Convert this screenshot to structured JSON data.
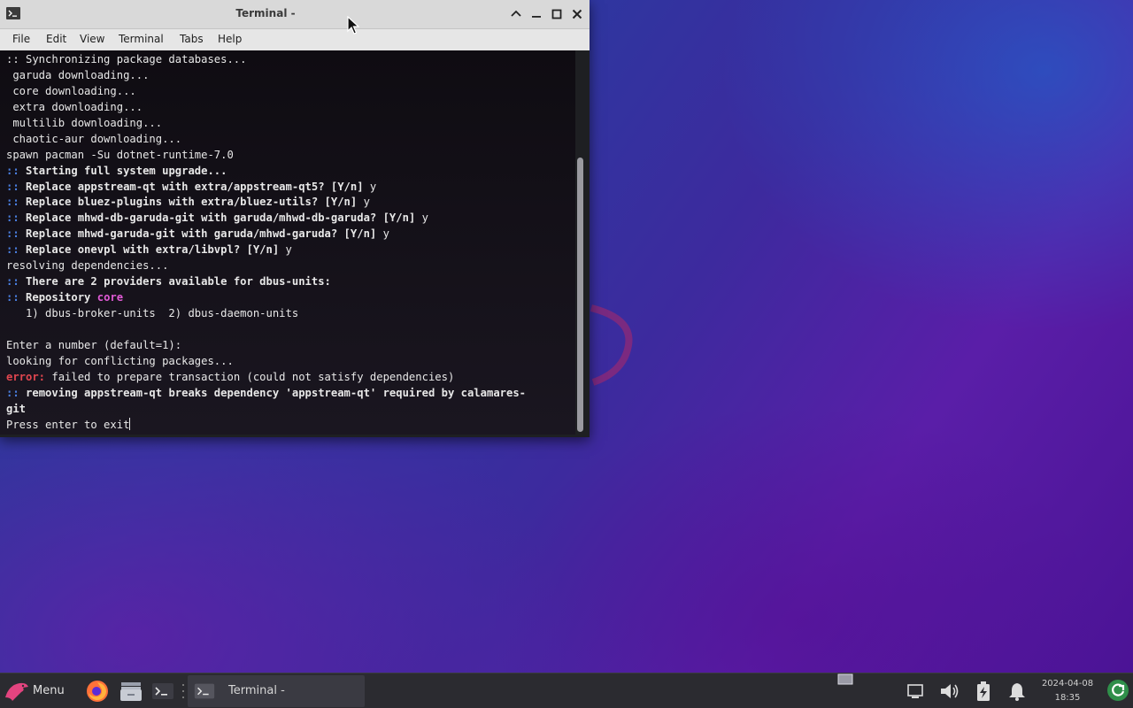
{
  "window": {
    "title": "Terminal -",
    "menu": [
      "File",
      "Edit",
      "View",
      "Terminal",
      "Tabs",
      "Help"
    ]
  },
  "terminal": {
    "lines": [
      [
        {
          "t": ":: Synchronizing package databases...",
          "s": ""
        }
      ],
      [
        {
          "t": " garuda downloading...",
          "s": ""
        }
      ],
      [
        {
          "t": " core downloading...",
          "s": ""
        }
      ],
      [
        {
          "t": " extra downloading...",
          "s": ""
        }
      ],
      [
        {
          "t": " multilib downloading...",
          "s": ""
        }
      ],
      [
        {
          "t": " chaotic-aur downloading...",
          "s": ""
        }
      ],
      [
        {
          "t": "spawn pacman -Su dotnet-runtime-7.0",
          "s": ""
        }
      ],
      [
        {
          "t": "::",
          "s": "blue"
        },
        {
          "t": " Starting full system upgrade...",
          "s": "b"
        }
      ],
      [
        {
          "t": "::",
          "s": "blue"
        },
        {
          "t": " Replace appstream-qt with extra/appstream-qt5? [Y/n]",
          "s": "b"
        },
        {
          "t": " y",
          "s": ""
        }
      ],
      [
        {
          "t": "::",
          "s": "blue"
        },
        {
          "t": " Replace bluez-plugins with extra/bluez-utils? [Y/n]",
          "s": "b"
        },
        {
          "t": " y",
          "s": ""
        }
      ],
      [
        {
          "t": "::",
          "s": "blue"
        },
        {
          "t": " Replace mhwd-db-garuda-git with garuda/mhwd-db-garuda? [Y/n]",
          "s": "b"
        },
        {
          "t": " y",
          "s": ""
        }
      ],
      [
        {
          "t": "::",
          "s": "blue"
        },
        {
          "t": " Replace mhwd-garuda-git with garuda/mhwd-garuda? [Y/n]",
          "s": "b"
        },
        {
          "t": " y",
          "s": ""
        }
      ],
      [
        {
          "t": "::",
          "s": "blue"
        },
        {
          "t": " Replace onevpl with extra/libvpl? [Y/n]",
          "s": "b"
        },
        {
          "t": " y",
          "s": ""
        }
      ],
      [
        {
          "t": "resolving dependencies...",
          "s": ""
        }
      ],
      [
        {
          "t": "::",
          "s": "blue"
        },
        {
          "t": " There are 2 providers available for dbus-units:",
          "s": "b"
        }
      ],
      [
        {
          "t": "::",
          "s": "blue"
        },
        {
          "t": " Repository ",
          "s": "b"
        },
        {
          "t": "core",
          "s": "mag"
        }
      ],
      [
        {
          "t": "   1) dbus-broker-units  2) dbus-daemon-units",
          "s": ""
        }
      ],
      [
        {
          "t": "",
          "s": ""
        }
      ],
      [
        {
          "t": "Enter a number (default=1):",
          "s": ""
        }
      ],
      [
        {
          "t": "looking for conflicting packages...",
          "s": ""
        }
      ],
      [
        {
          "t": "error:",
          "s": "red"
        },
        {
          "t": " failed to prepare transaction (could not satisfy dependencies)",
          "s": ""
        }
      ],
      [
        {
          "t": "::",
          "s": "blue"
        },
        {
          "t": " removing appstream-qt breaks dependency 'appstream-qt' required by calamares-",
          "s": "b"
        }
      ],
      [
        {
          "t": "git",
          "s": "b"
        }
      ],
      [
        {
          "t": "Press enter to exit",
          "s": ""
        }
      ]
    ]
  },
  "taskbar": {
    "menu_label": "Menu",
    "active_task_label": "Terminal -",
    "date": "2024-04-08",
    "time": "18:35"
  },
  "icons": {
    "window_icon": "terminal-icon",
    "menu_icon": "garuda-eagle-icon",
    "launchers": [
      "firefox-icon",
      "file-manager-icon",
      "terminal-icon"
    ],
    "tray": [
      "network-icon",
      "volume-icon",
      "battery-charging-icon",
      "notification-bell-icon",
      "update-icon"
    ]
  }
}
